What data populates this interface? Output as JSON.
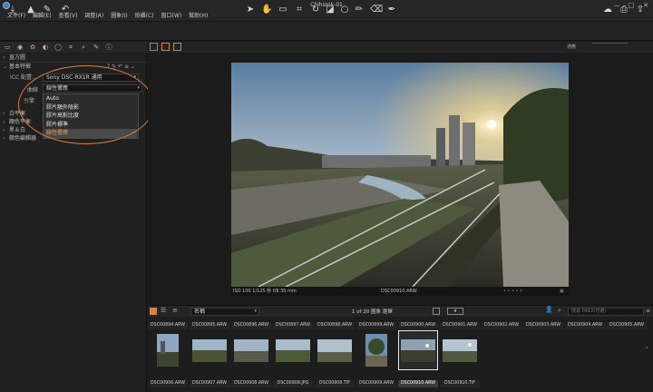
{
  "window": {
    "title": "Chihsmk-01",
    "minimize": "—",
    "maximize": "□",
    "close": "✕"
  },
  "menu": [
    "文件(F)",
    "編輯(E)",
    "查看(V)",
    "調整(A)",
    "圖象(I)",
    "拍攝(C)",
    "窗口(W)",
    "幫助(H)"
  ],
  "left_panel": {
    "sections": {
      "histogram": "直方圖",
      "base_characteristics": "基本特徵",
      "white_balance": "白平衡",
      "color_balance": "顏色平衡",
      "black_and_white": "黑＆白",
      "color_editor": "顏色編輯器"
    },
    "icc_label": "ICC 配置...",
    "icc_value": "Sony DSC-RX1R 通用",
    "curve_label": "曲線",
    "curve_value": "線性響應",
    "engine_label": "引擎",
    "curve_options": [
      "Auto",
      "膠片額外陰影",
      "膠片高對比度",
      "膠片標準",
      "線性響應"
    ],
    "selected_option_index": 4
  },
  "viewer": {
    "info_left": "ISO 100  1/125 秒  f/8  35 mm",
    "info_center": "DSC00910.ARW"
  },
  "browser": {
    "sort_value": "名稱",
    "page_info": "1 of 20 圖象 選擇",
    "search_placeholder": "搜尋 0912(可選)",
    "top_row": [
      "DSC00894.ARW",
      "DSC00895.ARW",
      "DSC00896.ARW",
      "DSC00897.ARW",
      "DSC00898.ARW",
      "DSC00899.ARW",
      "DSC00900.ARW",
      "DSC00901.ARW",
      "DSC00902.ARW",
      "DSC00903.ARW",
      "DSC00904.ARW",
      "DSC00905.ARW"
    ],
    "bottom_row": [
      "DSC00906.ARW",
      "DSC00907.ARW",
      "DSC00908.ARW",
      "DSC00908.JPG",
      "DSC00908.TIF",
      "DSC00909.ARW",
      "DSC00910.ARW",
      "DSC00910.TIF"
    ],
    "selected_index": 6
  },
  "colors": {
    "accent_orange": "#e0803a",
    "selected_text": "#d89a50"
  }
}
